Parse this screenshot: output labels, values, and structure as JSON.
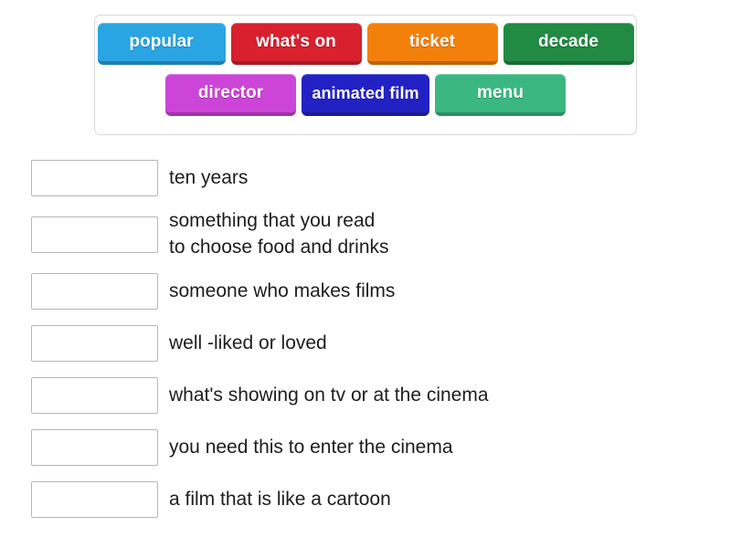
{
  "activity": {
    "type": "match-up",
    "tile_panel": {
      "rows": [
        [
          {
            "id": "popular",
            "label": "popular",
            "color": "#29a5e3",
            "text_color": "#ffffff"
          },
          {
            "id": "whats-on",
            "label": "what's on",
            "color": "#d8202f",
            "text_color": "#ffffff"
          },
          {
            "id": "ticket",
            "label": "ticket",
            "color": "#f4800c",
            "text_color": "#ffffff"
          },
          {
            "id": "decade",
            "label": "decade",
            "color": "#218a43",
            "text_color": "#ffffff"
          }
        ],
        [
          {
            "id": "director",
            "label": "director",
            "color": "#cc45d8",
            "text_color": "#ffffff"
          },
          {
            "id": "animated-film",
            "label": "animated\nfilm",
            "color": "#2222c4",
            "text_color": "#ffffff"
          },
          {
            "id": "menu",
            "label": "menu",
            "color": "#3bb882",
            "text_color": "#ffffff"
          }
        ]
      ]
    },
    "definition_rows": [
      {
        "id": "row-ten-years",
        "answer_value": "",
        "definition": "ten years"
      },
      {
        "id": "row-menu",
        "answer_value": "",
        "definition": "something that you read\nto choose food and drinks"
      },
      {
        "id": "row-director",
        "answer_value": "",
        "definition": "someone who makes films"
      },
      {
        "id": "row-popular",
        "answer_value": "",
        "definition": "well -liked or loved"
      },
      {
        "id": "row-whats-on",
        "answer_value": "",
        "definition": "what's showing on tv or at the cinema"
      },
      {
        "id": "row-ticket",
        "answer_value": "",
        "definition": "you need this to enter the cinema"
      },
      {
        "id": "row-animated-film",
        "answer_value": "",
        "definition": "a film that is like a cartoon"
      }
    ]
  }
}
